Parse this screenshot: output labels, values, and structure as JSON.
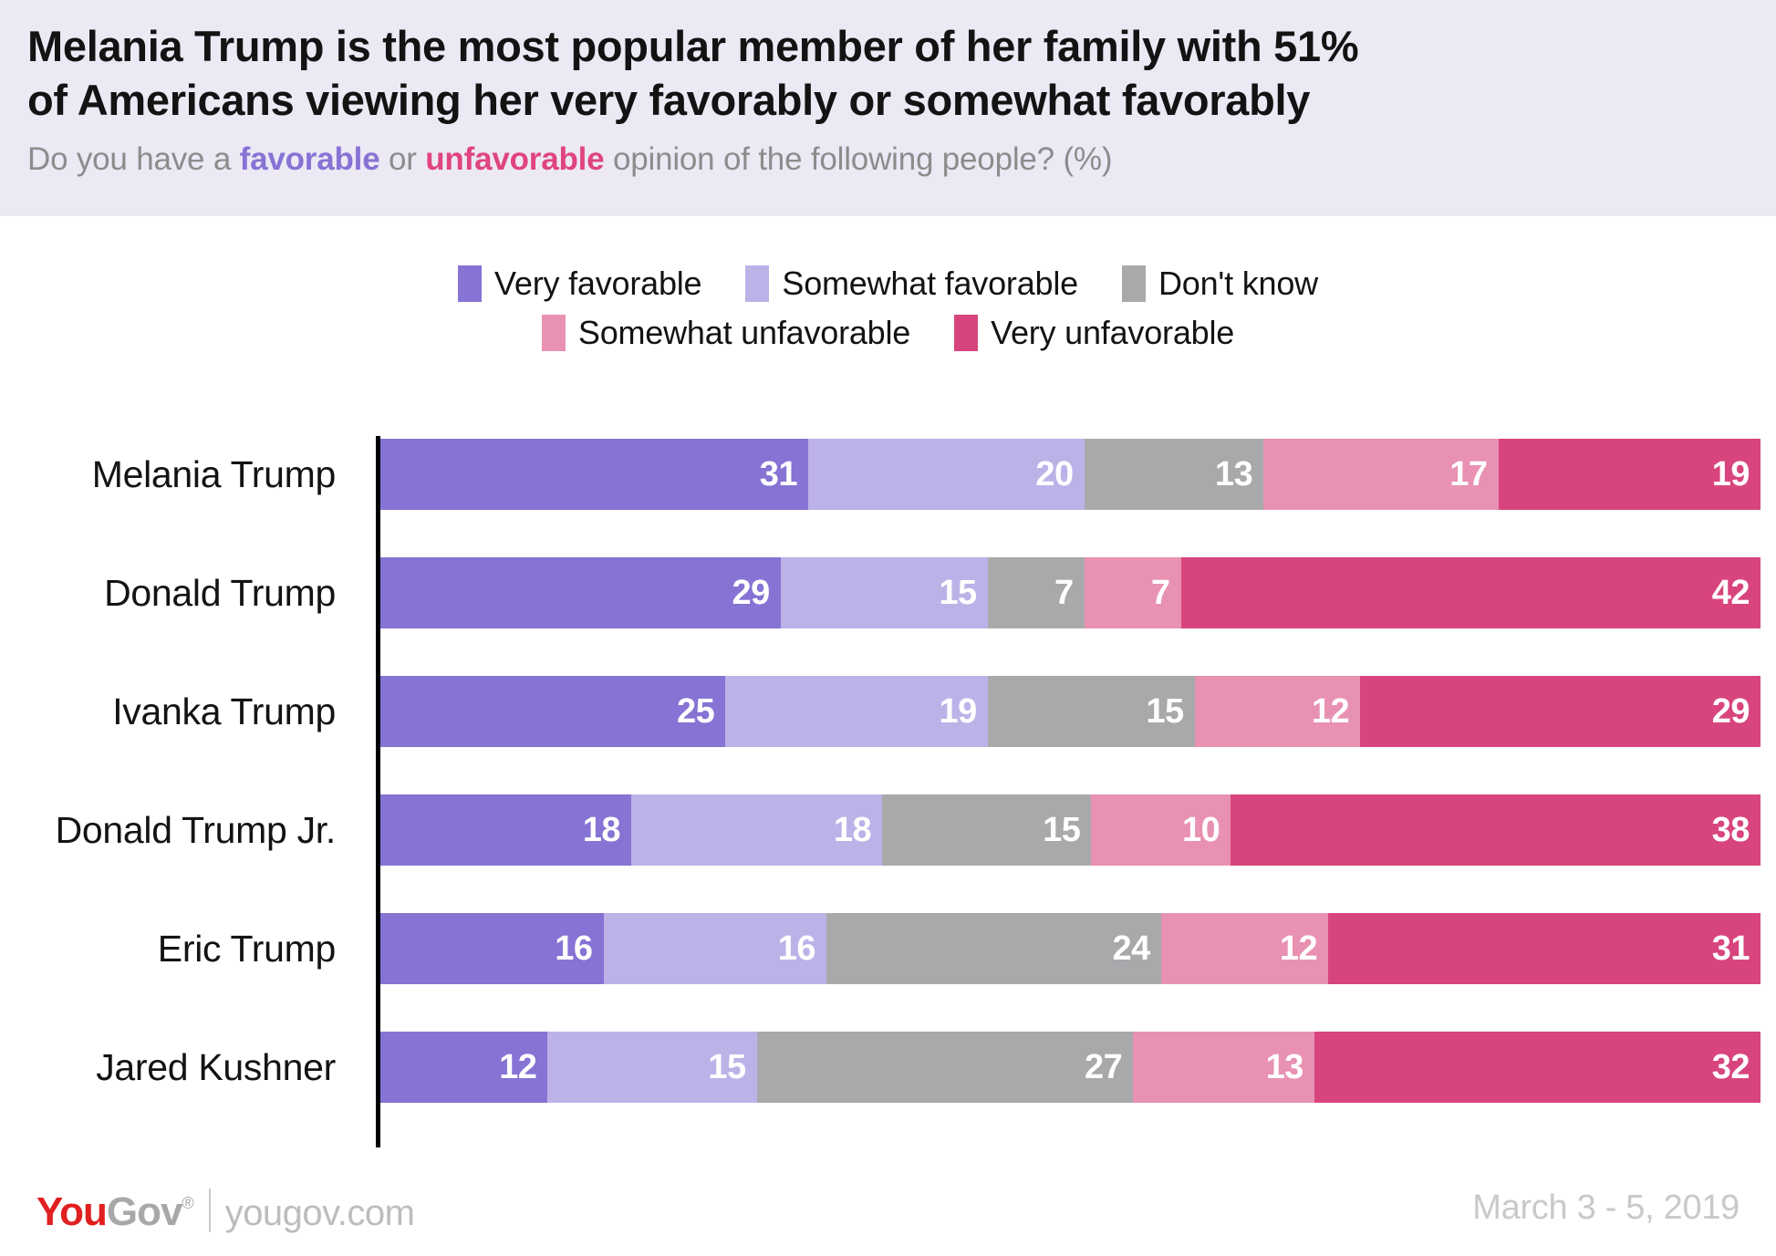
{
  "header": {
    "title": "Melania Trump is the most popular member of her family with 51%\nof Americans viewing her very favorably or somewhat favorably",
    "subtitle_parts": {
      "before": "Do you have a ",
      "favorable": "favorable",
      "middle": " or ",
      "unfavorable": "unfavorable",
      "after": " opinion of the following people? (%)"
    },
    "band_color": "#ece9f5"
  },
  "footer": {
    "logo_you": "You",
    "logo_gov": "Gov",
    "logo_reg": "®",
    "url": "yougov.com",
    "field_dates": "March 3 - 5, 2019"
  },
  "legend": {
    "rows": [
      [
        {
          "label": "Very favorable",
          "color": "#8673d4"
        },
        {
          "label": "Somewhat favorable",
          "color": "#bdb2e8"
        },
        {
          "label": "Don't know",
          "color": "#a9a9ac"
        }
      ],
      [
        {
          "label": "Somewhat unfavorable",
          "color": "#e891b3"
        },
        {
          "label": "Very unfavorable",
          "color": "#d8457e"
        }
      ]
    ]
  },
  "chart_data": {
    "type": "bar",
    "orientation": "horizontal",
    "stacked": true,
    "normalized_percent": true,
    "title": "Melania Trump is the most popular member of her family with 51% of Americans viewing her very favorably or somewhat favorably",
    "subtitle": "Do you have a favorable or unfavorable opinion of the following people? (%)",
    "xlabel": "",
    "ylabel": "",
    "xlim": [
      0,
      100
    ],
    "grid": false,
    "legend_position": "top-center",
    "categories": [
      "Melania Trump",
      "Donald Trump",
      "Ivanka Trump",
      "Donald Trump Jr.",
      "Eric Trump",
      "Jared Kushner"
    ],
    "series": [
      {
        "name": "Very favorable",
        "color": "#8673d4",
        "values": [
          31,
          29,
          25,
          18,
          16,
          12
        ]
      },
      {
        "name": "Somewhat favorable",
        "color": "#bdb2e8",
        "values": [
          20,
          15,
          19,
          18,
          16,
          15
        ]
      },
      {
        "name": "Don't know",
        "color": "#a9a9ac",
        "values": [
          13,
          7,
          15,
          15,
          24,
          27
        ]
      },
      {
        "name": "Somewhat unfavorable",
        "color": "#e891b3",
        "values": [
          17,
          7,
          12,
          10,
          12,
          13
        ]
      },
      {
        "name": "Very unfavorable",
        "color": "#d8457e",
        "values": [
          19,
          42,
          29,
          38,
          31,
          32
        ]
      }
    ]
  }
}
